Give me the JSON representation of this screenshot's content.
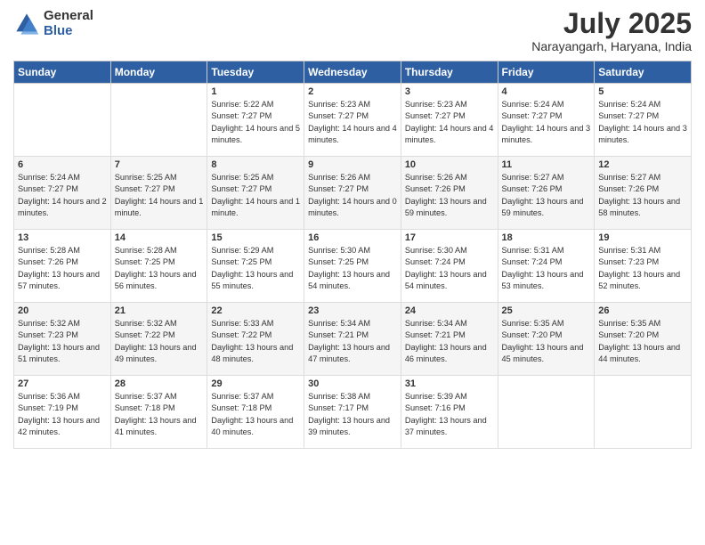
{
  "logo": {
    "general": "General",
    "blue": "Blue"
  },
  "header": {
    "month": "July 2025",
    "location": "Narayangarh, Haryana, India"
  },
  "weekdays": [
    "Sunday",
    "Monday",
    "Tuesday",
    "Wednesday",
    "Thursday",
    "Friday",
    "Saturday"
  ],
  "weeks": [
    [
      {
        "day": "",
        "info": ""
      },
      {
        "day": "",
        "info": ""
      },
      {
        "day": "1",
        "info": "Sunrise: 5:22 AM\nSunset: 7:27 PM\nDaylight: 14 hours and 5 minutes."
      },
      {
        "day": "2",
        "info": "Sunrise: 5:23 AM\nSunset: 7:27 PM\nDaylight: 14 hours and 4 minutes."
      },
      {
        "day": "3",
        "info": "Sunrise: 5:23 AM\nSunset: 7:27 PM\nDaylight: 14 hours and 4 minutes."
      },
      {
        "day": "4",
        "info": "Sunrise: 5:24 AM\nSunset: 7:27 PM\nDaylight: 14 hours and 3 minutes."
      },
      {
        "day": "5",
        "info": "Sunrise: 5:24 AM\nSunset: 7:27 PM\nDaylight: 14 hours and 3 minutes."
      }
    ],
    [
      {
        "day": "6",
        "info": "Sunrise: 5:24 AM\nSunset: 7:27 PM\nDaylight: 14 hours and 2 minutes."
      },
      {
        "day": "7",
        "info": "Sunrise: 5:25 AM\nSunset: 7:27 PM\nDaylight: 14 hours and 1 minute."
      },
      {
        "day": "8",
        "info": "Sunrise: 5:25 AM\nSunset: 7:27 PM\nDaylight: 14 hours and 1 minute."
      },
      {
        "day": "9",
        "info": "Sunrise: 5:26 AM\nSunset: 7:27 PM\nDaylight: 14 hours and 0 minutes."
      },
      {
        "day": "10",
        "info": "Sunrise: 5:26 AM\nSunset: 7:26 PM\nDaylight: 13 hours and 59 minutes."
      },
      {
        "day": "11",
        "info": "Sunrise: 5:27 AM\nSunset: 7:26 PM\nDaylight: 13 hours and 59 minutes."
      },
      {
        "day": "12",
        "info": "Sunrise: 5:27 AM\nSunset: 7:26 PM\nDaylight: 13 hours and 58 minutes."
      }
    ],
    [
      {
        "day": "13",
        "info": "Sunrise: 5:28 AM\nSunset: 7:26 PM\nDaylight: 13 hours and 57 minutes."
      },
      {
        "day": "14",
        "info": "Sunrise: 5:28 AM\nSunset: 7:25 PM\nDaylight: 13 hours and 56 minutes."
      },
      {
        "day": "15",
        "info": "Sunrise: 5:29 AM\nSunset: 7:25 PM\nDaylight: 13 hours and 55 minutes."
      },
      {
        "day": "16",
        "info": "Sunrise: 5:30 AM\nSunset: 7:25 PM\nDaylight: 13 hours and 54 minutes."
      },
      {
        "day": "17",
        "info": "Sunrise: 5:30 AM\nSunset: 7:24 PM\nDaylight: 13 hours and 54 minutes."
      },
      {
        "day": "18",
        "info": "Sunrise: 5:31 AM\nSunset: 7:24 PM\nDaylight: 13 hours and 53 minutes."
      },
      {
        "day": "19",
        "info": "Sunrise: 5:31 AM\nSunset: 7:23 PM\nDaylight: 13 hours and 52 minutes."
      }
    ],
    [
      {
        "day": "20",
        "info": "Sunrise: 5:32 AM\nSunset: 7:23 PM\nDaylight: 13 hours and 51 minutes."
      },
      {
        "day": "21",
        "info": "Sunrise: 5:32 AM\nSunset: 7:22 PM\nDaylight: 13 hours and 49 minutes."
      },
      {
        "day": "22",
        "info": "Sunrise: 5:33 AM\nSunset: 7:22 PM\nDaylight: 13 hours and 48 minutes."
      },
      {
        "day": "23",
        "info": "Sunrise: 5:34 AM\nSunset: 7:21 PM\nDaylight: 13 hours and 47 minutes."
      },
      {
        "day": "24",
        "info": "Sunrise: 5:34 AM\nSunset: 7:21 PM\nDaylight: 13 hours and 46 minutes."
      },
      {
        "day": "25",
        "info": "Sunrise: 5:35 AM\nSunset: 7:20 PM\nDaylight: 13 hours and 45 minutes."
      },
      {
        "day": "26",
        "info": "Sunrise: 5:35 AM\nSunset: 7:20 PM\nDaylight: 13 hours and 44 minutes."
      }
    ],
    [
      {
        "day": "27",
        "info": "Sunrise: 5:36 AM\nSunset: 7:19 PM\nDaylight: 13 hours and 42 minutes."
      },
      {
        "day": "28",
        "info": "Sunrise: 5:37 AM\nSunset: 7:18 PM\nDaylight: 13 hours and 41 minutes."
      },
      {
        "day": "29",
        "info": "Sunrise: 5:37 AM\nSunset: 7:18 PM\nDaylight: 13 hours and 40 minutes."
      },
      {
        "day": "30",
        "info": "Sunrise: 5:38 AM\nSunset: 7:17 PM\nDaylight: 13 hours and 39 minutes."
      },
      {
        "day": "31",
        "info": "Sunrise: 5:39 AM\nSunset: 7:16 PM\nDaylight: 13 hours and 37 minutes."
      },
      {
        "day": "",
        "info": ""
      },
      {
        "day": "",
        "info": ""
      }
    ]
  ]
}
